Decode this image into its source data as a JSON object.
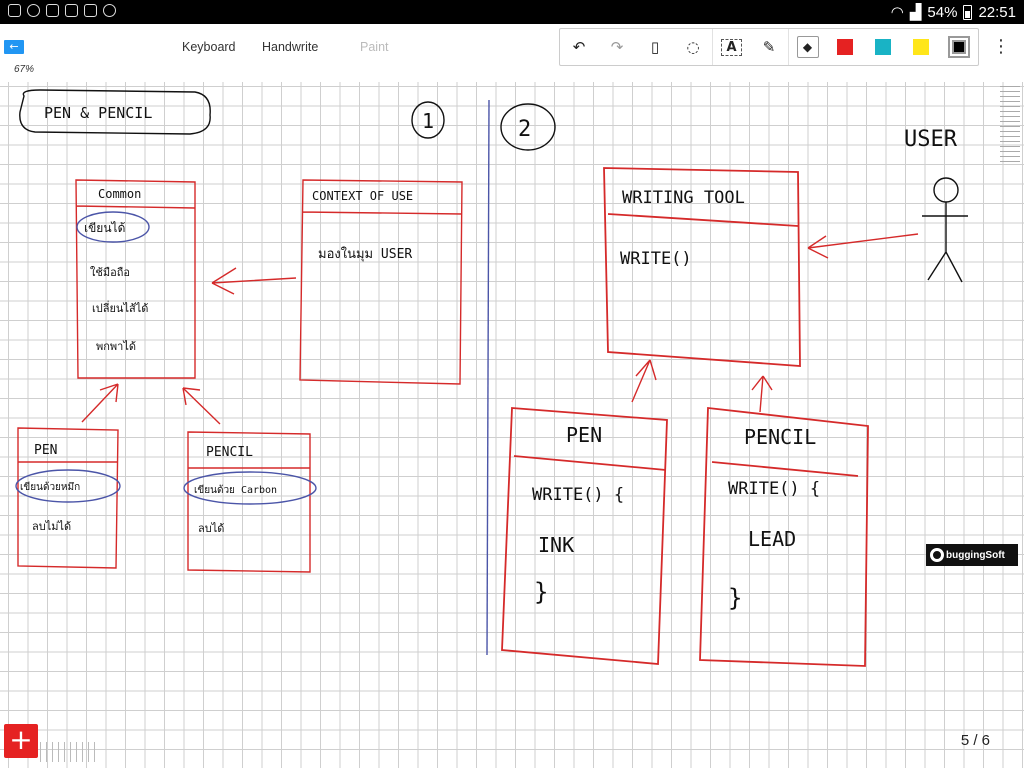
{
  "status_bar": {
    "battery": "54%",
    "time": "22:51"
  },
  "toolbar": {
    "modes": [
      "Keyboard",
      "Handwrite",
      "Paint"
    ],
    "active_mode": "Handwrite",
    "text_tool_label": "A",
    "colors": {
      "red": "#e52222",
      "teal": "#19b3c5",
      "yellow": "#ffe61a",
      "black": "#000000"
    },
    "zoom": "67%"
  },
  "ink_colors": {
    "red": "#d52a2a",
    "blue": "#4b55a8",
    "black": "#111111"
  },
  "sketch": {
    "left": {
      "title": "PEN & PENCIL",
      "page_marker": "1",
      "common_box": {
        "header": "Common",
        "items": [
          "เขียนได้",
          "ใช้มือถือ",
          "เปลี่ยนไส้ได้",
          "พกพาได้"
        ]
      },
      "context_box": {
        "header": "CONTEXT OF USE",
        "body": "มองในมุม USER"
      },
      "pen_box": {
        "header": "PEN",
        "line1": "เขียนด้วยหมึก",
        "line2": "ลบไม่ได้"
      },
      "pencil_box": {
        "header": "PENCIL",
        "line1": "เขียนด้วย Carbon",
        "line2": "ลบได้"
      }
    },
    "right": {
      "page_marker": "2",
      "actor": "USER",
      "writing_tool": {
        "header": "WRITING TOOL",
        "method": "WRITE()"
      },
      "pen": {
        "header": "PEN",
        "method": "WRITE() {",
        "body": "INK",
        "close": "}"
      },
      "pencil": {
        "header": "PENCIL",
        "method": "WRITE() {",
        "body": "LEAD",
        "close": "}"
      }
    }
  },
  "watermark": "buggingSoft",
  "page_indicator": "5 / 6"
}
